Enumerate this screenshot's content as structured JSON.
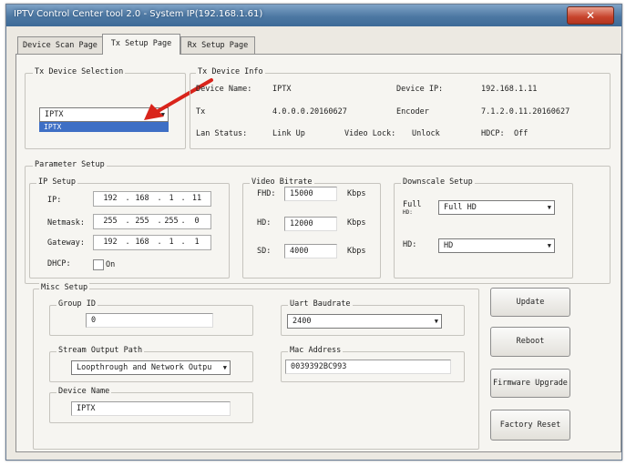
{
  "window": {
    "title": "IPTV Control Center tool 2.0 - System IP(192.168.1.61)",
    "close_label": "✕"
  },
  "tabs": [
    "Device Scan Page",
    "Tx Setup Page",
    "Rx Setup Page"
  ],
  "tx_device_selection": {
    "title": "Tx Device Selection",
    "selected": "IPTX",
    "dropdown_items": [
      "IPTX"
    ]
  },
  "tx_device_info": {
    "title": "Tx Device Info",
    "device_name_label": "Device Name:",
    "device_name_value": "IPTX",
    "device_ip_label": "Device IP:",
    "device_ip_value": "192.168.1.11",
    "tx_label": "Tx",
    "tx_value": "4.0.0.0.20160627",
    "encoder_label": "Encoder",
    "encoder_value": "7.1.2.0.11.20160627",
    "lan_status_label": "Lan Status:",
    "lan_status_value": "Link Up",
    "video_lock_label": "Video Lock:",
    "video_lock_value": "Unlock",
    "hdcp_label": "HDCP:",
    "hdcp_value": "Off"
  },
  "parameter_setup": {
    "title": "Parameter Setup",
    "ip_setup": {
      "title": "IP Setup",
      "ip_label": "IP:",
      "ip": [
        "192",
        "168",
        "1",
        "11"
      ],
      "netmask_label": "Netmask:",
      "netmask": [
        "255",
        "255",
        "255",
        "0"
      ],
      "gateway_label": "Gateway:",
      "gateway": [
        "192",
        "168",
        "1",
        "1"
      ],
      "dhcp_label": "DHCP:",
      "dhcp_on_label": "On"
    },
    "video_bitrate": {
      "title": "Video Bitrate",
      "fhd_label": "FHD:",
      "fhd_value": "15000",
      "hd_label": "HD:",
      "hd_value": "12000",
      "sd_label": "SD:",
      "sd_value": "4000",
      "unit": "Kbps"
    },
    "downscale_setup": {
      "title": "Downscale Setup",
      "full_label": "Full",
      "full_sub": "HD:",
      "full_value": "Full HD",
      "hd_label": "HD:",
      "hd_value": "HD"
    }
  },
  "misc_setup": {
    "title": "Misc Setup",
    "group_id_label": "Group ID",
    "group_id_value": "0",
    "uart_label": "Uart Baudrate",
    "uart_value": "2400",
    "stream_output_label": "Stream Output Path",
    "stream_output_value": "Loopthrough and Network Outpu",
    "mac_label": "Mac Address",
    "mac_value": "0039392BC993",
    "device_name_label": "Device Name",
    "device_name_value": "IPTX"
  },
  "buttons": {
    "update": "Update",
    "reboot": "Reboot",
    "firmware_upgrade": "Firmware Upgrade",
    "factory_reset": "Factory Reset"
  },
  "colors": {
    "annotation_arrow": "#d9241b",
    "title_bar": "#4d78a3",
    "selection": "#3e6fc5"
  }
}
